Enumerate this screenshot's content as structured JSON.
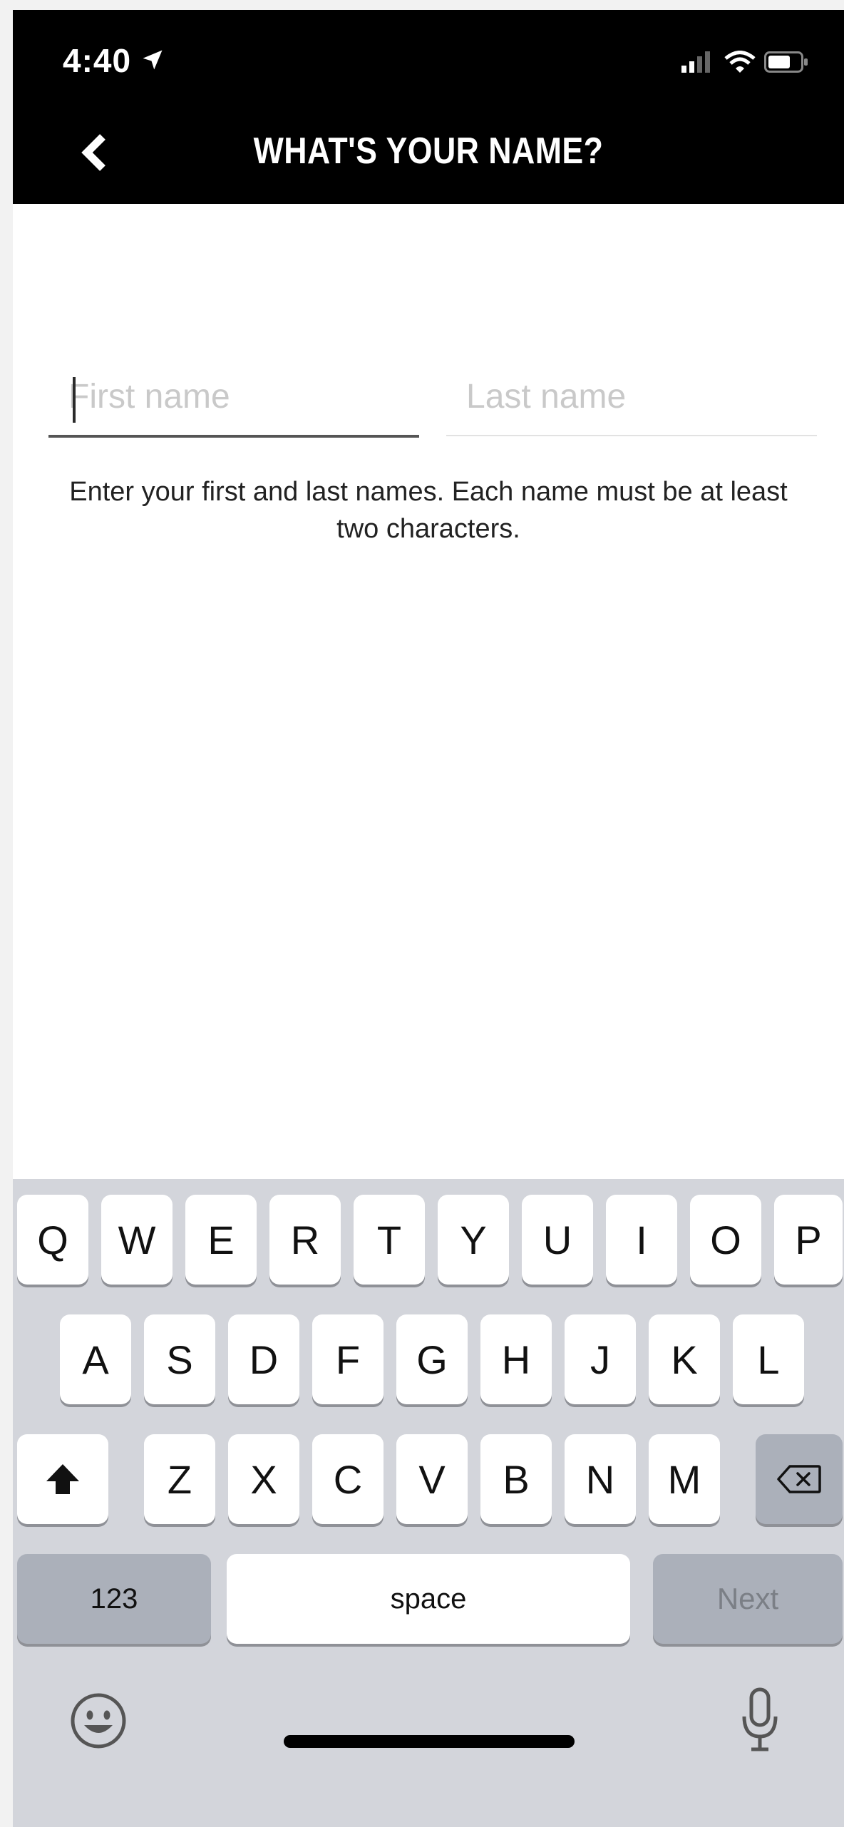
{
  "status_bar": {
    "time": "4:40"
  },
  "header": {
    "title": "WHAT'S YOUR NAME?"
  },
  "form": {
    "first_name_placeholder": "First name",
    "last_name_placeholder": "Last name",
    "hint": "Enter your first and last names. Each name must be at least two characters."
  },
  "keyboard": {
    "row1": [
      "Q",
      "W",
      "E",
      "R",
      "T",
      "Y",
      "U",
      "I",
      "O",
      "P"
    ],
    "row2": [
      "A",
      "S",
      "D",
      "F",
      "G",
      "H",
      "J",
      "K",
      "L"
    ],
    "row3": [
      "Z",
      "X",
      "C",
      "V",
      "B",
      "N",
      "M"
    ],
    "numbers_label": "123",
    "space_label": "space",
    "next_label": "Next"
  },
  "colors": {
    "header_bg": "#000000",
    "keyboard_bg": "#d3d5db",
    "key_bg": "#ffffff",
    "key_dark_bg": "#abb0ba"
  }
}
